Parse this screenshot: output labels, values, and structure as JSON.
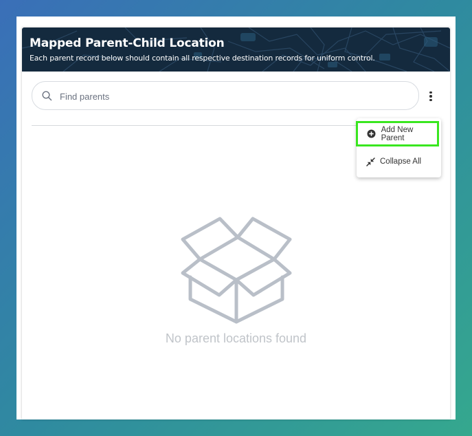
{
  "header": {
    "title": "Mapped Parent-Child Location",
    "subtitle": "Each parent record below should contain all respective destination records for uniform control."
  },
  "search": {
    "placeholder": "Find parents",
    "value": ""
  },
  "menu": {
    "items": [
      {
        "label": "Add New Parent",
        "icon": "plus-circle-icon"
      },
      {
        "label": "Collapse All",
        "icon": "collapse-arrows-icon"
      }
    ]
  },
  "empty_state": {
    "icon": "open-box-icon",
    "message": "No parent locations found"
  },
  "colors": {
    "banner_bg": "#142a3e",
    "highlight": "#39e61f",
    "empty_icon": "#b9bfc8"
  }
}
